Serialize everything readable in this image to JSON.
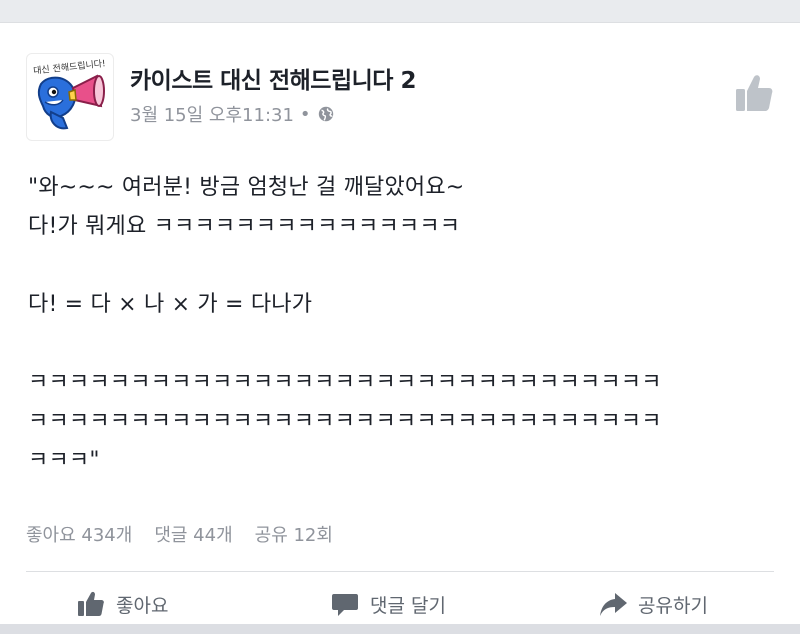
{
  "post": {
    "page_name": "카이스트 대신 전해드립니다 2",
    "avatar_text": "대신 전해드립니다!",
    "date": "3월 15일 오후11:31",
    "separator": "•",
    "text": "\"와~~~ 여러분! 방금 엄청난 걸 깨달았어요~\n다!가 뭐게요 ㅋㅋㅋㅋㅋㅋㅋㅋㅋㅋㅋㅋㅋㅋㅋ\n\n다! = 다 × 나 × 가 = 다나가\n\nㅋㅋㅋㅋㅋㅋㅋㅋㅋㅋㅋㅋㅋㅋㅋㅋㅋㅋㅋㅋㅋㅋㅋㅋㅋㅋㅋㅋㅋㅋㅋ\nㅋㅋㅋㅋㅋㅋㅋㅋㅋㅋㅋㅋㅋㅋㅋㅋㅋㅋㅋㅋㅋㅋㅋㅋㅋㅋㅋㅋㅋㅋㅋ\nㅋㅋㅋ\""
  },
  "stats": {
    "likes": "좋아요 434개",
    "comments": "댓글 44개",
    "shares": "공유 12회"
  },
  "actions": {
    "like": "좋아요",
    "comment": "댓글 달기",
    "share": "공유하기"
  },
  "icons": {
    "header_like": "thumbs-up-icon",
    "privacy": "globe-icon",
    "like": "thumbs-up-icon",
    "comment": "speech-bubble-icon",
    "share": "share-arrow-icon"
  },
  "colors": {
    "text": "#1d2129",
    "muted": "#90949c",
    "action": "#606770",
    "icon_gray": "#bec3c9",
    "avatar_blue": "#2a6fdc",
    "megaphone_pink": "#e8508a"
  }
}
